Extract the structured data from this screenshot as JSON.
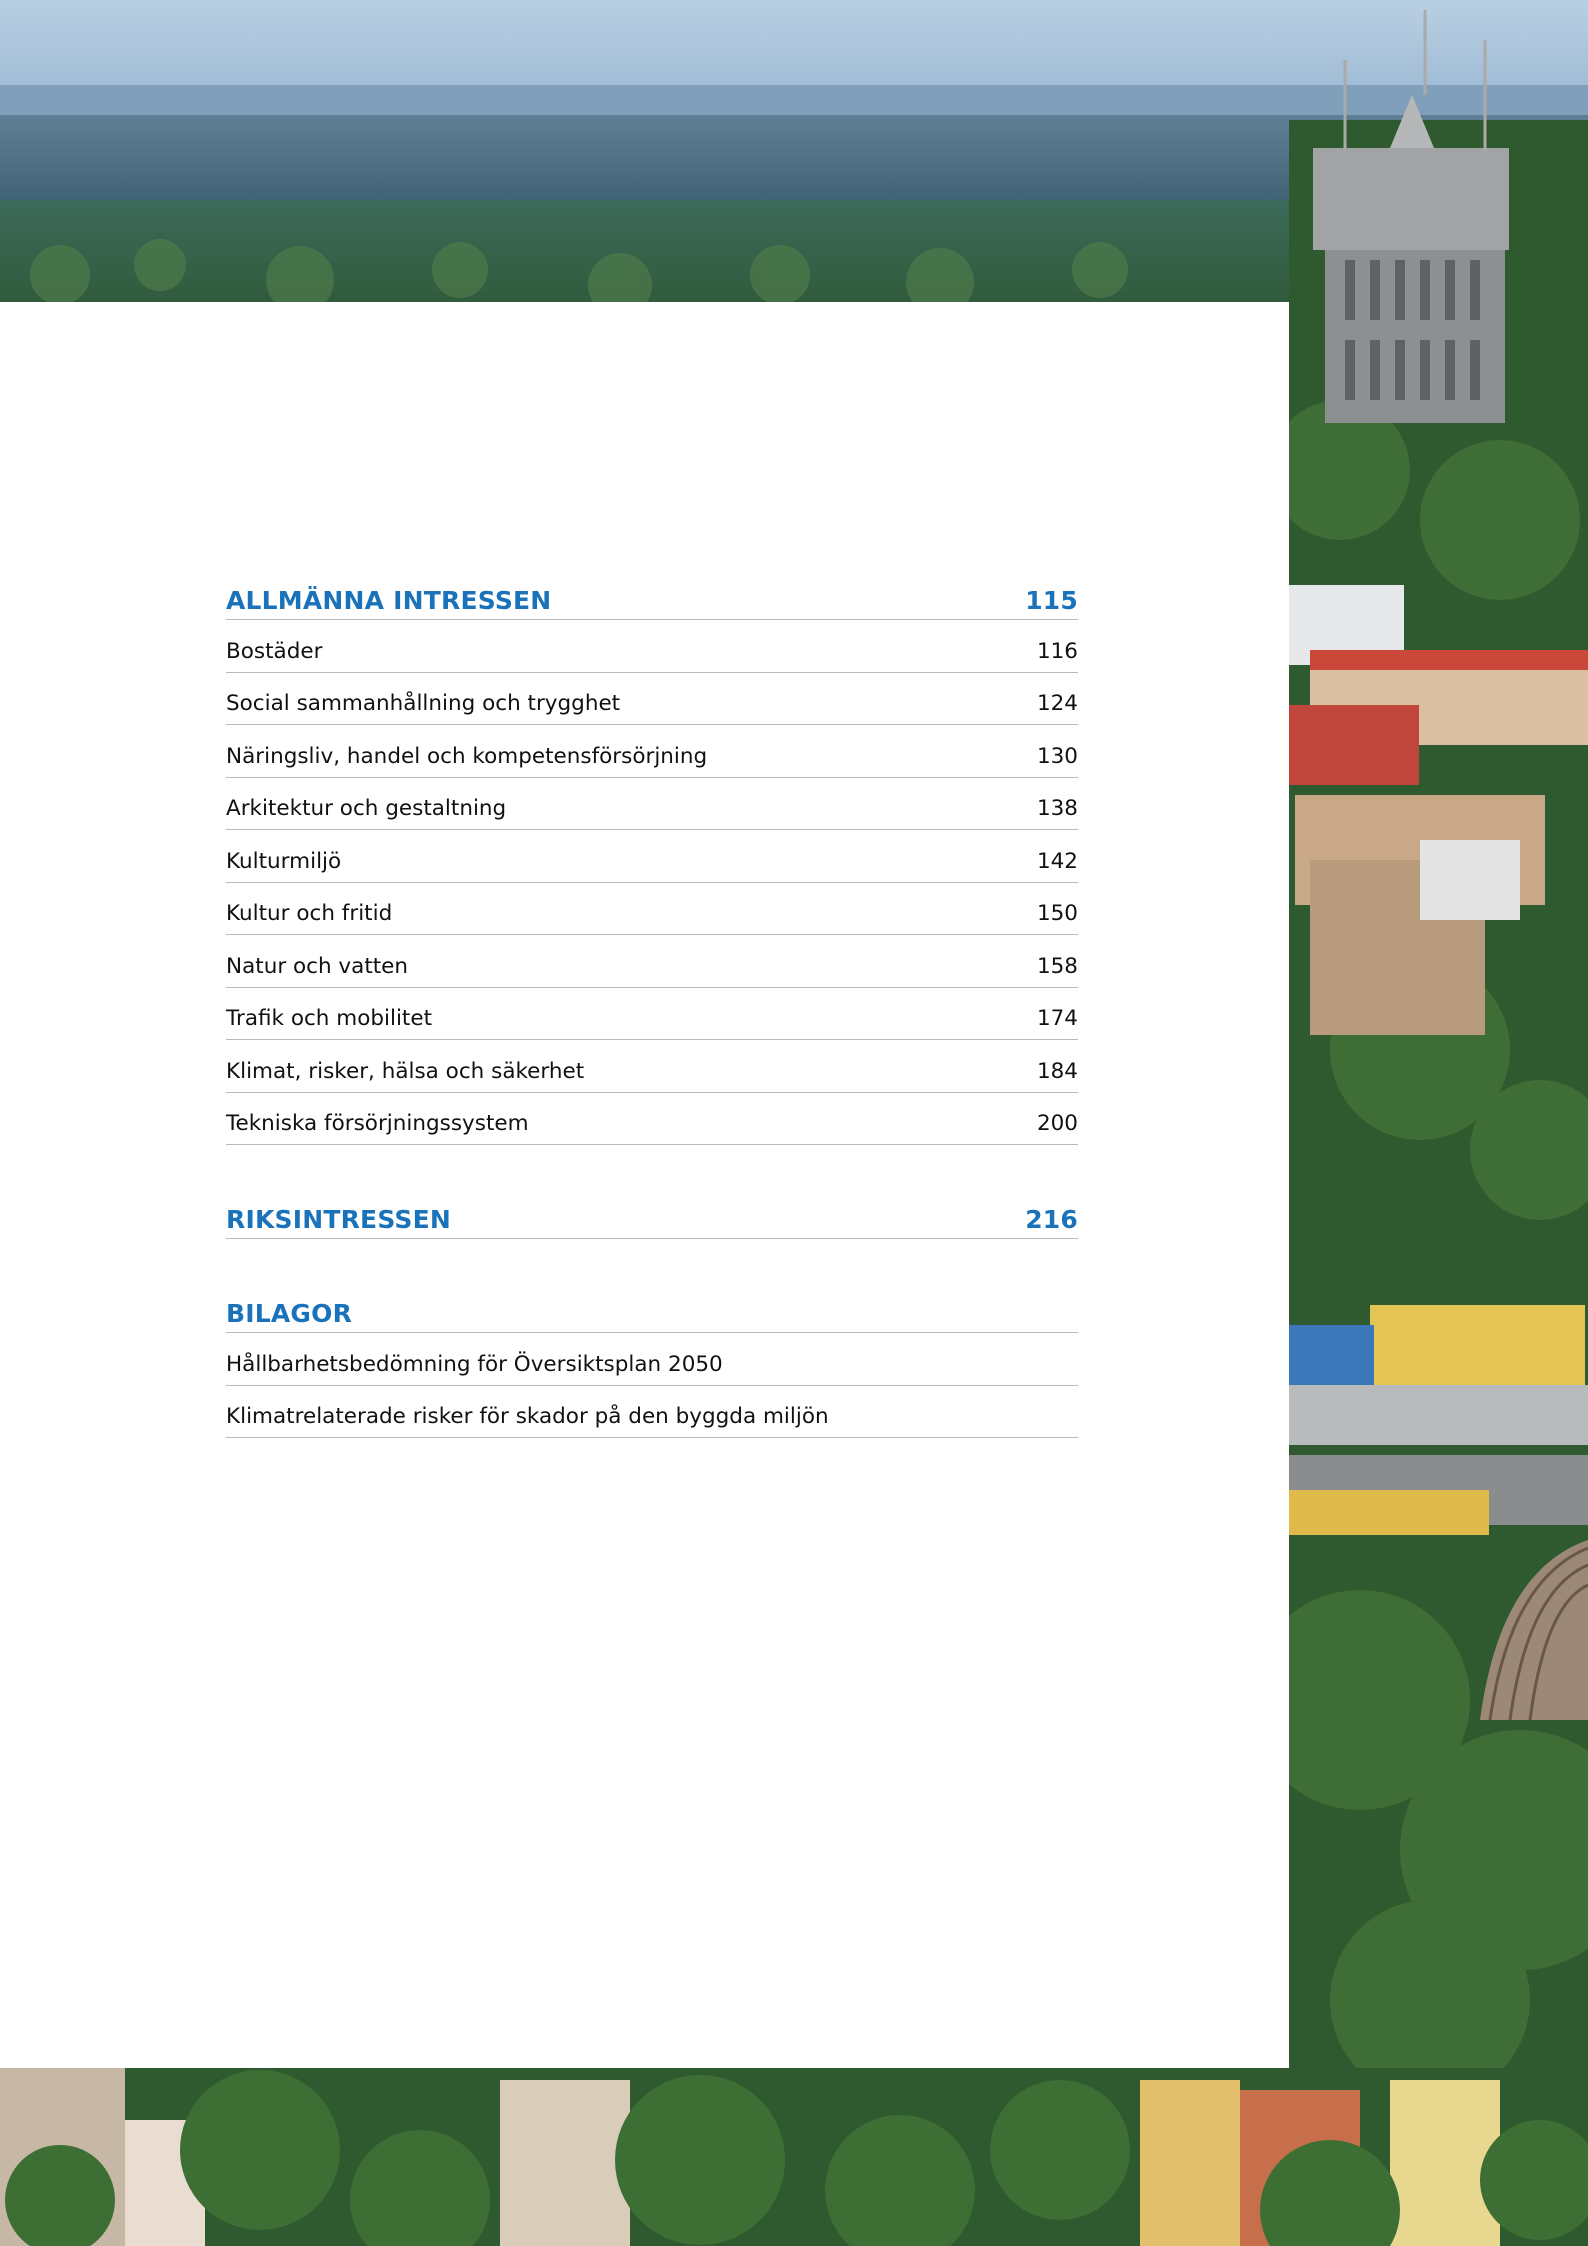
{
  "toc": {
    "sections": [
      {
        "title": "ALLMÄNNA INTRESSEN",
        "page": "115",
        "items": [
          {
            "label": "Bostäder",
            "page": "116"
          },
          {
            "label": "Social sammanhållning och trygghet",
            "page": "124"
          },
          {
            "label": "Näringsliv, handel och kompetensförsörjning",
            "page": "130"
          },
          {
            "label": "Arkitektur och gestaltning",
            "page": "138"
          },
          {
            "label": "Kulturmiljö",
            "page": "142"
          },
          {
            "label": "Kultur och fritid",
            "page": "150"
          },
          {
            "label": "Natur och vatten",
            "page": "158"
          },
          {
            "label": "Trafik och mobilitet",
            "page": "174"
          },
          {
            "label": "Klimat, risker, hälsa och säkerhet",
            "page": "184"
          },
          {
            "label": "Tekniska försörjningssystem",
            "page": "200"
          }
        ]
      },
      {
        "title": "RIKSINTRESSEN",
        "page": "216",
        "items": []
      },
      {
        "title": "BILAGOR",
        "page": "",
        "items": [
          {
            "label": "Hållbarhetsbedömning för Översiktsplan 2050",
            "page": ""
          },
          {
            "label": "Klimatrelaterade risker för skador på den byggda miljön",
            "page": ""
          }
        ]
      }
    ]
  },
  "colors": {
    "heading": "#1a73ba",
    "text": "#111111",
    "rule": "#b9b9b9"
  }
}
